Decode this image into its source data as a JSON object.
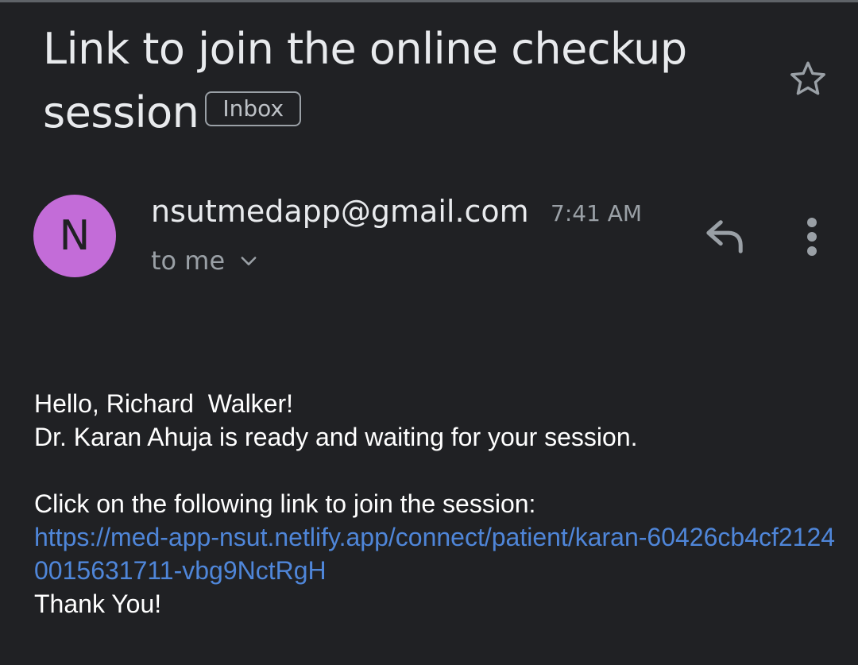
{
  "email": {
    "subject": "Link to join the online checkup session",
    "label": "Inbox",
    "sender": {
      "avatar_letter": "N",
      "address": "nsutmedapp@gmail.com",
      "time": "7:41 AM",
      "recipients": "to me"
    },
    "body": {
      "greeting": "Hello, Richard  Walker!",
      "line2": "Dr. Karan Ahuja is ready and waiting for your session.",
      "instruction": "Click on the following link to join the session:",
      "link": "https://med-app-nsut.netlify.app/connect/patient/karan-60426cb4cf21240015631711-vbg9NctRgH",
      "signoff": "Thank You!"
    }
  },
  "icons": {
    "star": "star-outline-icon",
    "reply": "reply-icon",
    "more": "more-vert-icon",
    "expand": "chevron-down-icon"
  },
  "colors": {
    "background": "#202124",
    "avatar": "#c36cd8",
    "link": "#4f86d9",
    "secondary_text": "#9aa0a6"
  }
}
